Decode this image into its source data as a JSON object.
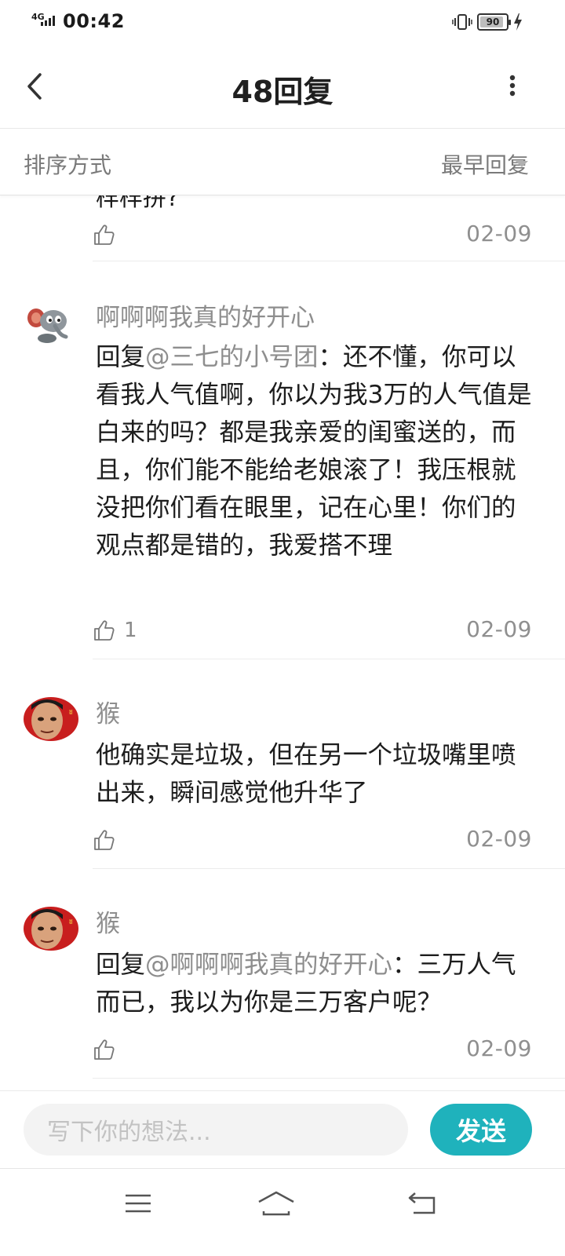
{
  "status_bar": {
    "network": "4G",
    "time": "00:42",
    "battery": "90",
    "battery_level": 0.9
  },
  "header": {
    "title": "48回复"
  },
  "sort": {
    "label": "排序方式",
    "selected": "最早回复"
  },
  "comments": [
    {
      "partial_text": "样样拼?",
      "likes": "",
      "date": "02-09"
    },
    {
      "author": "啊啊啊我真的好开心",
      "reply_prefix": "回复",
      "mention": "@三七的小号团",
      "text": "：还不懂，你可以看我人气值啊，你以为我3万的人气值是白来的吗？都是我亲爱的闺蜜送的，而且，你们能不能给老娘滚了！我压根就没把你们看在眼里，记在心里！你们的观点都是错的，我爱搭不理",
      "likes": "1",
      "date": "02-09"
    },
    {
      "author": "猴",
      "text": "他确实是垃圾，但在另一个垃圾嘴里喷出来，瞬间感觉他升华了",
      "likes": "",
      "date": "02-09"
    },
    {
      "author": "猴",
      "reply_prefix": "回复",
      "mention": "@啊啊啊我真的好开心",
      "text": "：三万人气而已，我以为你是三万客户呢？",
      "likes": "",
      "date": "02-09"
    }
  ],
  "input": {
    "placeholder": "写下你的想法...",
    "send_label": "发送"
  },
  "colors": {
    "accent": "#1fb2bc",
    "muted_text": "#8e8e8e",
    "text": "#1d1d1d"
  }
}
